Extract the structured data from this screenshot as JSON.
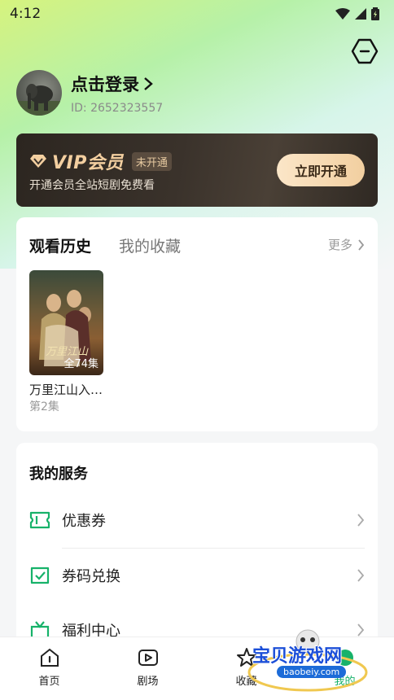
{
  "status_bar": {
    "time": "4:12"
  },
  "profile": {
    "login_text": "点击登录",
    "user_id": "ID: 2652323557"
  },
  "vip": {
    "title": "VIP会员",
    "badge": "未开通",
    "description": "开通会员全站短剧免费看",
    "button_label": "立即开通"
  },
  "history": {
    "tabs": [
      {
        "label": "观看历史",
        "active": true
      },
      {
        "label": "我的收藏",
        "active": false
      }
    ],
    "more_label": "更多",
    "items": [
      {
        "title": "万里江山入…",
        "episode": "第2集",
        "total": "全74集"
      }
    ]
  },
  "services": {
    "title": "我的服务",
    "items": [
      {
        "label": "优惠券",
        "icon": "coupon-icon"
      },
      {
        "label": "券码兑换",
        "icon": "redeem-icon"
      },
      {
        "label": "福利中心",
        "icon": "gift-icon"
      }
    ]
  },
  "bottom_nav": [
    {
      "label": "首页",
      "icon": "home-icon"
    },
    {
      "label": "剧场",
      "icon": "play-icon"
    },
    {
      "label": "收藏",
      "icon": "star-icon"
    },
    {
      "label": "我的",
      "icon": "user-icon"
    }
  ],
  "watermark": {
    "text": "宝贝游戏网",
    "url": "baobeiy.com"
  },
  "colors": {
    "accent": "#17b26a",
    "vip_gold": "#f3cfa0",
    "vip_dark": "#2c2620"
  }
}
